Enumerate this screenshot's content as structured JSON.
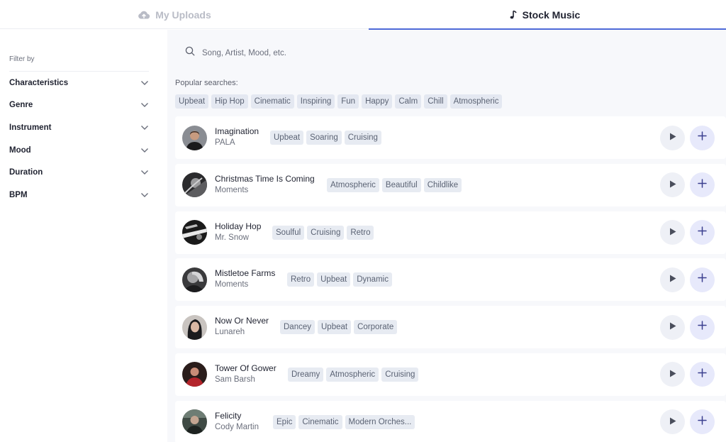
{
  "tabs": [
    {
      "label": "My Uploads",
      "icon": "cloud-upload-icon",
      "active": false
    },
    {
      "label": "Stock Music",
      "icon": "music-note-icon",
      "active": true
    }
  ],
  "sidebar": {
    "filter_by": "Filter by",
    "filters": [
      "Characteristics",
      "Genre",
      "Instrument",
      "Mood",
      "Duration",
      "BPM"
    ]
  },
  "search": {
    "placeholder": "Song, Artist, Mood, etc.",
    "value": ""
  },
  "popular": {
    "label": "Popular searches:",
    "tags": [
      "Upbeat",
      "Hip Hop",
      "Cinematic",
      "Inspiring",
      "Fun",
      "Happy",
      "Calm",
      "Chill",
      "Atmospheric"
    ]
  },
  "tracks": [
    {
      "title": "Imagination",
      "artist": "PALA",
      "tags": [
        "Upbeat",
        "Soaring",
        "Cruising"
      ]
    },
    {
      "title": "Christmas Time Is Coming",
      "artist": "Moments",
      "tags": [
        "Atmospheric",
        "Beautiful",
        "Childlike"
      ]
    },
    {
      "title": "Holiday Hop",
      "artist": "Mr. Snow",
      "tags": [
        "Soulful",
        "Cruising",
        "Retro"
      ]
    },
    {
      "title": "Mistletoe Farms",
      "artist": "Moments",
      "tags": [
        "Retro",
        "Upbeat",
        "Dynamic"
      ]
    },
    {
      "title": "Now Or Never",
      "artist": "Lunareh",
      "tags": [
        "Dancey",
        "Upbeat",
        "Corporate"
      ]
    },
    {
      "title": "Tower Of Gower",
      "artist": "Sam Barsh",
      "tags": [
        "Dreamy",
        "Atmospheric",
        "Cruising"
      ]
    },
    {
      "title": "Felicity",
      "artist": "Cody Martin",
      "tags": [
        "Epic",
        "Cinematic",
        "Modern Orches..."
      ]
    }
  ],
  "colors": {
    "accent": "#4e6ad8",
    "add_button_bg": "#e7e9fb",
    "plus_icon": "#3a3f8f"
  }
}
